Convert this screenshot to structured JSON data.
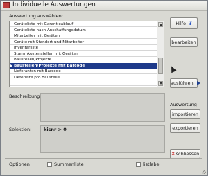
{
  "window": {
    "title": "Individuelle Auswertungen"
  },
  "list": {
    "label": "Auswertung auswählen:",
    "items": [
      "Geräteliste mit Garantieablauf",
      "Geräteliste nach Anschaffungsdatum",
      "Mitarbeiter mit Geräten",
      "Geräte mit Standort und Mitarbeiter",
      "Inventarliste",
      "Stammkostenstellen mit Geräten",
      "Baustellen/Projekte",
      "Baustellen/Projekte mit Barcode",
      "Lieferanten mit Barcode",
      "Lieferliste pro Baustelle",
      ""
    ],
    "selected_index": 7
  },
  "buttons": {
    "help": "Hilfe",
    "edit": "bearbeiten",
    "run": "ausführen",
    "import": "importieren",
    "export": "exportieren",
    "close": "schliessen"
  },
  "fields": {
    "description_label": "Beschreibung:",
    "description_value": "",
    "selection_label": "Selektion:",
    "selection_value": "kisnr > 0"
  },
  "evaluation_group_label": "Auswertung",
  "options": {
    "label": "Optionen",
    "summary_list": {
      "label": "Summenliste",
      "checked": false
    },
    "list_label": {
      "label": "listlabel",
      "checked": false
    }
  }
}
